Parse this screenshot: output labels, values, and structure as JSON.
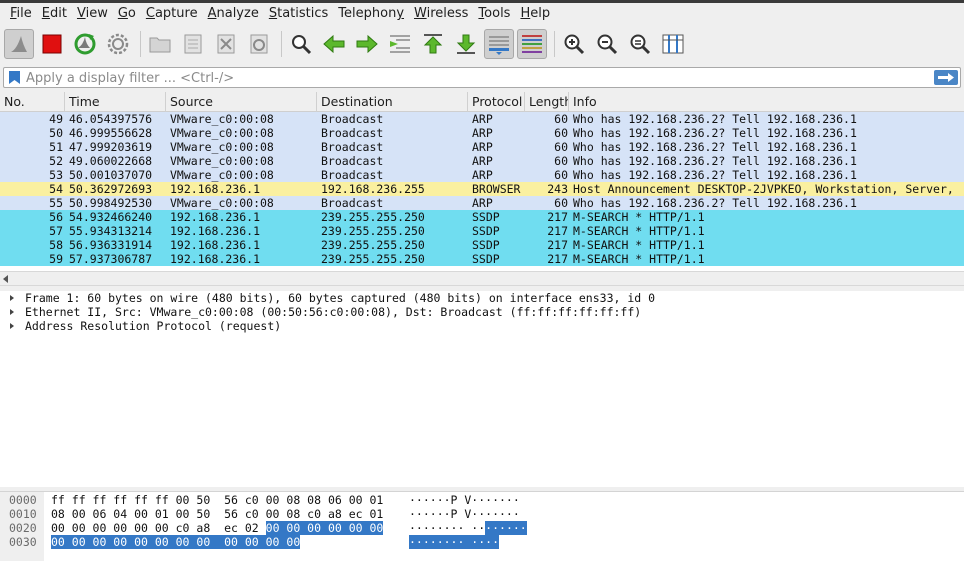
{
  "menu": [
    {
      "key": "file",
      "u": "F",
      "rest": "ile"
    },
    {
      "key": "edit",
      "u": "E",
      "rest": "dit"
    },
    {
      "key": "view",
      "u": "V",
      "rest": "iew"
    },
    {
      "key": "go",
      "u": "G",
      "rest": "o"
    },
    {
      "key": "capture",
      "u": "C",
      "rest": "apture"
    },
    {
      "key": "analyze",
      "u": "A",
      "rest": "nalyze"
    },
    {
      "key": "statistics",
      "u": "S",
      "rest": "tatistics"
    },
    {
      "key": "telephony",
      "pre": "Telephon",
      "u": "y",
      "rest": ""
    },
    {
      "key": "wireless",
      "u": "W",
      "rest": "ireless"
    },
    {
      "key": "tools",
      "u": "T",
      "rest": "ools"
    },
    {
      "key": "help",
      "u": "H",
      "rest": "elp"
    }
  ],
  "filter": {
    "placeholder": "Apply a display filter ... <Ctrl-/>"
  },
  "columns": {
    "no": "No.",
    "time": "Time",
    "source": "Source",
    "destination": "Destination",
    "protocol": "Protocol",
    "length": "Length",
    "info": "Info"
  },
  "row_colors": {
    "arp": "#d6e3f7",
    "browser": "#faf0a0",
    "ssdp": "#70ddf0"
  },
  "packets": [
    {
      "no": "49",
      "time": "46.054397576",
      "source": "VMware_c0:00:08",
      "destination": "Broadcast",
      "protocol": "ARP",
      "length": "60",
      "info": "Who has 192.168.236.2? Tell 192.168.236.1",
      "color": "arp"
    },
    {
      "no": "50",
      "time": "46.999556628",
      "source": "VMware_c0:00:08",
      "destination": "Broadcast",
      "protocol": "ARP",
      "length": "60",
      "info": "Who has 192.168.236.2? Tell 192.168.236.1",
      "color": "arp"
    },
    {
      "no": "51",
      "time": "47.999203619",
      "source": "VMware_c0:00:08",
      "destination": "Broadcast",
      "protocol": "ARP",
      "length": "60",
      "info": "Who has 192.168.236.2? Tell 192.168.236.1",
      "color": "arp"
    },
    {
      "no": "52",
      "time": "49.060022668",
      "source": "VMware_c0:00:08",
      "destination": "Broadcast",
      "protocol": "ARP",
      "length": "60",
      "info": "Who has 192.168.236.2? Tell 192.168.236.1",
      "color": "arp"
    },
    {
      "no": "53",
      "time": "50.001037070",
      "source": "VMware_c0:00:08",
      "destination": "Broadcast",
      "protocol": "ARP",
      "length": "60",
      "info": "Who has 192.168.236.2? Tell 192.168.236.1",
      "color": "arp"
    },
    {
      "no": "54",
      "time": "50.362972693",
      "source": "192.168.236.1",
      "destination": "192.168.236.255",
      "protocol": "BROWSER",
      "length": "243",
      "info": "Host Announcement DESKTOP-2JVPKEO, Workstation, Server,",
      "color": "browser"
    },
    {
      "no": "55",
      "time": "50.998492530",
      "source": "VMware_c0:00:08",
      "destination": "Broadcast",
      "protocol": "ARP",
      "length": "60",
      "info": "Who has 192.168.236.2? Tell 192.168.236.1",
      "color": "arp"
    },
    {
      "no": "56",
      "time": "54.932466240",
      "source": "192.168.236.1",
      "destination": "239.255.255.250",
      "protocol": "SSDP",
      "length": "217",
      "info": "M-SEARCH * HTTP/1.1",
      "color": "ssdp"
    },
    {
      "no": "57",
      "time": "55.934313214",
      "source": "192.168.236.1",
      "destination": "239.255.255.250",
      "protocol": "SSDP",
      "length": "217",
      "info": "M-SEARCH * HTTP/1.1",
      "color": "ssdp"
    },
    {
      "no": "58",
      "time": "56.936331914",
      "source": "192.168.236.1",
      "destination": "239.255.255.250",
      "protocol": "SSDP",
      "length": "217",
      "info": "M-SEARCH * HTTP/1.1",
      "color": "ssdp"
    },
    {
      "no": "59",
      "time": "57.937306787",
      "source": "192.168.236.1",
      "destination": "239.255.255.250",
      "protocol": "SSDP",
      "length": "217",
      "info": "M-SEARCH * HTTP/1.1",
      "color": "ssdp"
    }
  ],
  "details": [
    "Frame 1: 60 bytes on wire (480 bits), 60 bytes captured (480 bits) on interface ens33, id 0",
    "Ethernet II, Src: VMware_c0:00:08 (00:50:56:c0:00:08), Dst: Broadcast (ff:ff:ff:ff:ff:ff)",
    "Address Resolution Protocol (request)"
  ],
  "bytes": [
    {
      "offset": "0000",
      "hex": "ff ff ff ff ff ff 00 50  56 c0 00 08 08 06 00 01",
      "hex_hl": "",
      "ascii": "······P V·······",
      "ascii_hl": ""
    },
    {
      "offset": "0010",
      "hex": "08 00 06 04 00 01 00 50  56 c0 00 08 c0 a8 ec 01",
      "hex_hl": "",
      "ascii": "······P V·······",
      "ascii_hl": ""
    },
    {
      "offset": "0020",
      "hex": "00 00 00 00 00 00 c0 a8  ec 02 ",
      "hex_hl": "00 00 00 00 00 00",
      "ascii": "········ ··",
      "ascii_hl": "······"
    },
    {
      "offset": "0030",
      "hex": "",
      "hex_hl": "00 00 00 00 00 00 00 00  00 00 00 00",
      "ascii": "",
      "ascii_hl": "········ ····"
    }
  ]
}
